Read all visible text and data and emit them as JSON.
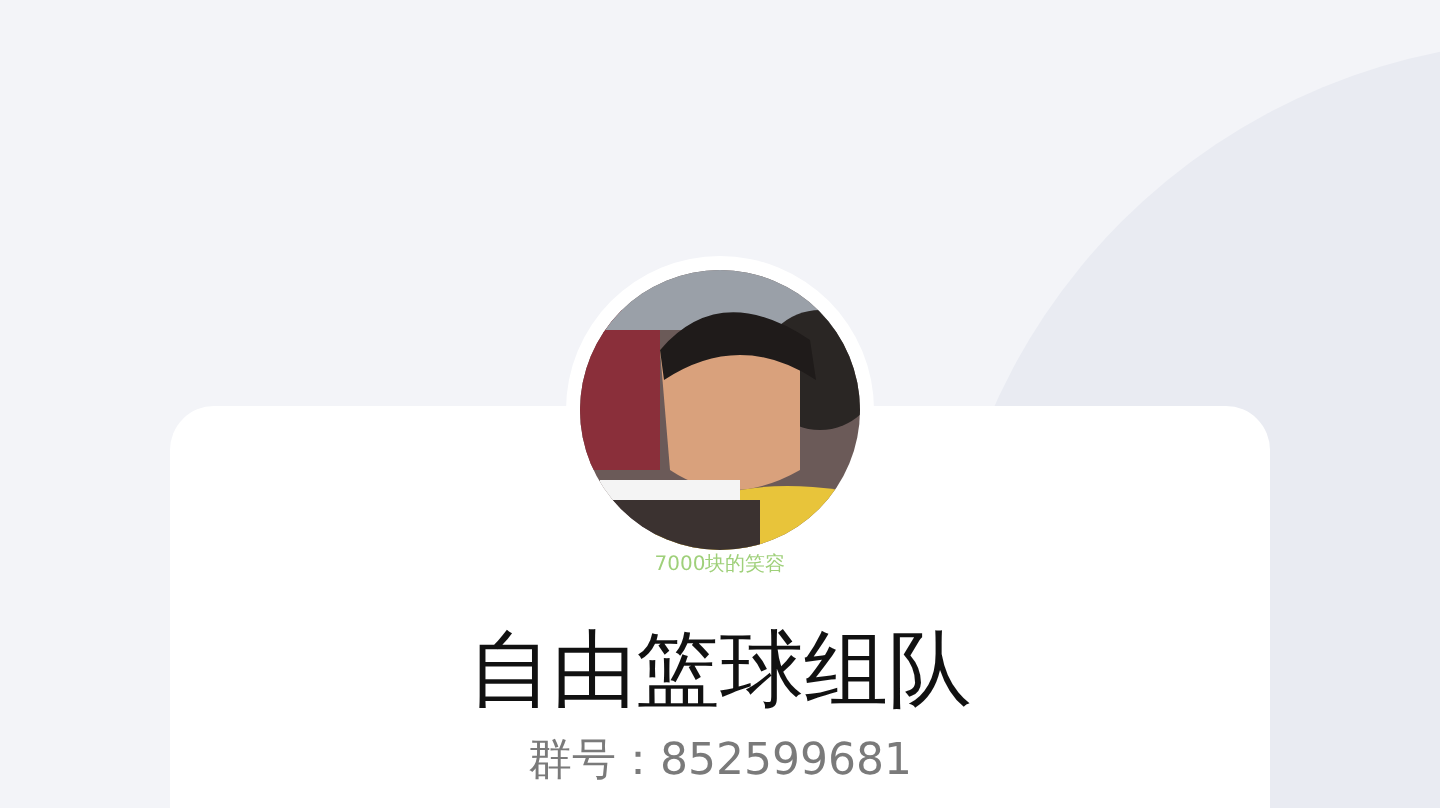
{
  "group": {
    "avatar": {
      "kind": "picture",
      "caption": "7000块的笑容"
    },
    "name": "自由篮球组队",
    "number_label": "群号：",
    "number": "852599681"
  }
}
